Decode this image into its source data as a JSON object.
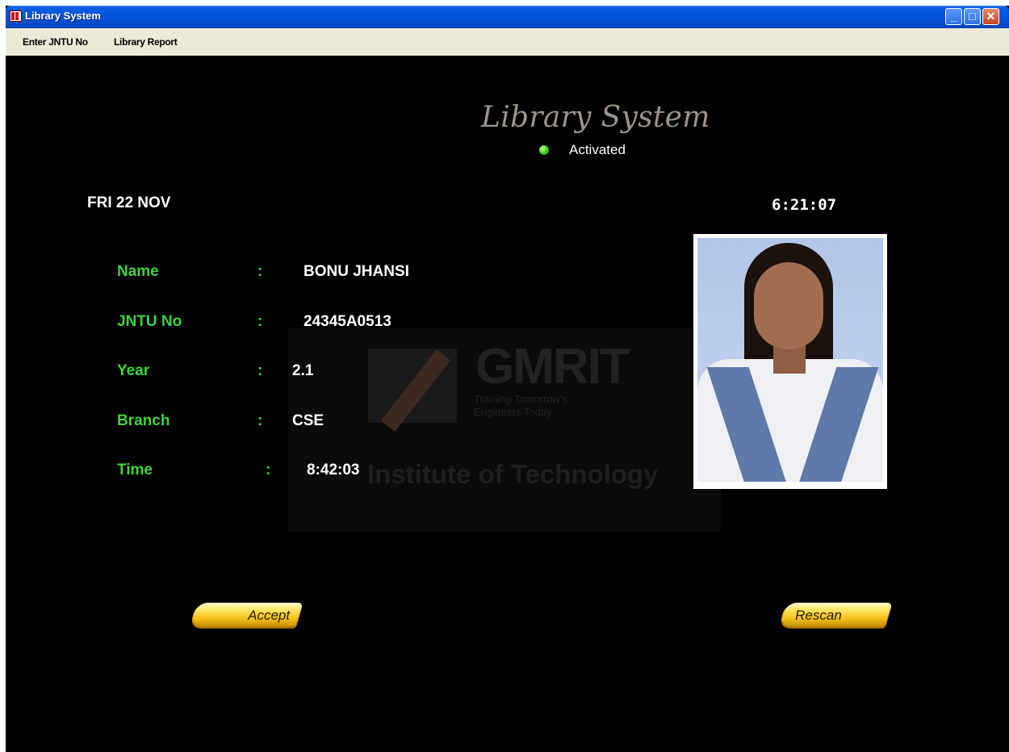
{
  "window": {
    "title": "Library System",
    "controls": {
      "minimize": "_",
      "maximize": "□",
      "close": "✕"
    }
  },
  "menu": {
    "items": [
      "Enter JNTU No",
      "Library Report"
    ]
  },
  "header": {
    "title": "Library System",
    "status": "Activated",
    "status_color": "#31c41a"
  },
  "date": "FRI 22 NOV",
  "clock": "6:21:07",
  "fields": [
    {
      "label": "Name",
      "value": "BONU JHANSI"
    },
    {
      "label": "JNTU No",
      "value": "24345A0513"
    },
    {
      "label": "Year",
      "value": "2.1"
    },
    {
      "label": "Branch",
      "value": "CSE"
    },
    {
      "label": "Time",
      "value": "8:42:03"
    }
  ],
  "separator": ":",
  "watermark": {
    "brand": "GMRIT",
    "tagline_1": "Training Tomorrow's",
    "tagline_2": "Engineers Today",
    "institute": "Institute of Technology"
  },
  "buttons": {
    "accept": "Accept",
    "rescan": "Rescan"
  },
  "colors": {
    "label_green": "#3cd33c",
    "button_gold": "#f4c21c",
    "titlebar_blue": "#0553d8"
  }
}
